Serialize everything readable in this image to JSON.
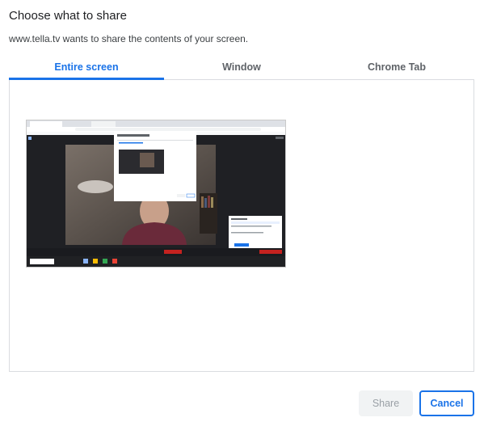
{
  "dialog": {
    "title": "Choose what to share",
    "subtitle": "www.tella.tv wants to share the contents of your screen."
  },
  "tabs": [
    {
      "label": "Entire screen",
      "active": true
    },
    {
      "label": "Window",
      "active": false
    },
    {
      "label": "Chrome Tab",
      "active": false
    }
  ],
  "screens": [
    {
      "name": "screen-1-thumbnail",
      "selected": false
    }
  ],
  "buttons": {
    "share_label": "Share",
    "share_enabled": false,
    "cancel_label": "Cancel"
  },
  "colors": {
    "accent": "#1a73e8",
    "disabled_text": "#9aa0a6",
    "border": "#dadce0"
  }
}
